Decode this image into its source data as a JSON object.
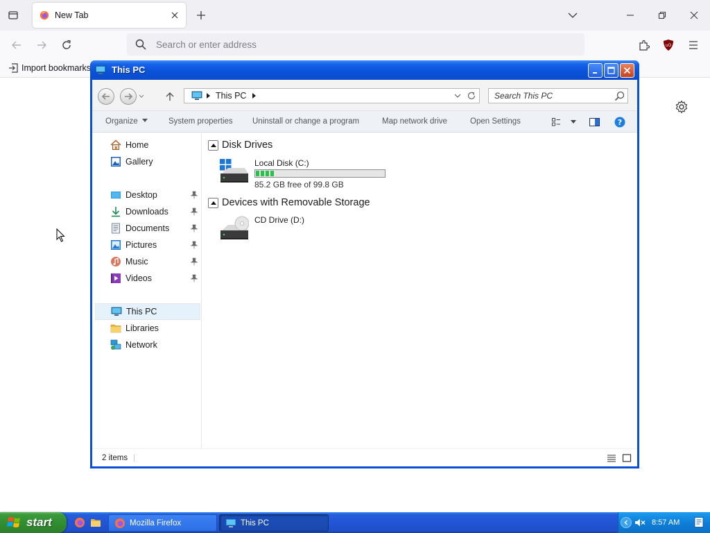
{
  "browser": {
    "tab": {
      "title": "New Tab"
    },
    "urlbar": {
      "placeholder": "Search or enter address"
    },
    "bookmarks": {
      "import_label": "Import bookmarks"
    }
  },
  "explorer": {
    "title": "This PC",
    "address": {
      "location": "This PC"
    },
    "search": {
      "placeholder": "Search This PC"
    },
    "commands": {
      "organize": "Organize",
      "system_properties": "System properties",
      "uninstall": "Uninstall or change a program",
      "map_drive": "Map network drive",
      "open_settings": "Open Settings"
    },
    "nav": {
      "home": "Home",
      "gallery": "Gallery",
      "desktop": "Desktop",
      "downloads": "Downloads",
      "documents": "Documents",
      "pictures": "Pictures",
      "music": "Music",
      "videos": "Videos",
      "this_pc": "This PC",
      "libraries": "Libraries",
      "network": "Network"
    },
    "groups": {
      "disk_drives": "Disk Drives",
      "removable": "Devices with Removable Storage"
    },
    "drives": {
      "c": {
        "name": "Local Disk (C:)",
        "free_text": "85.2 GB free of 99.8 GB",
        "used_fraction": 0.146
      },
      "d": {
        "name": "CD Drive (D:)"
      }
    },
    "status": {
      "items": "2 items"
    }
  },
  "taskbar": {
    "start": "start",
    "tasks": {
      "firefox": "Mozilla Firefox",
      "explorer": "This PC"
    },
    "clock": "8:57 AM"
  },
  "colors": {
    "xp_title_blue": "#0a52d8",
    "taskbar_blue": "#245edb",
    "start_green": "#3c9a3c",
    "drive_bar_green": "#28c246"
  }
}
